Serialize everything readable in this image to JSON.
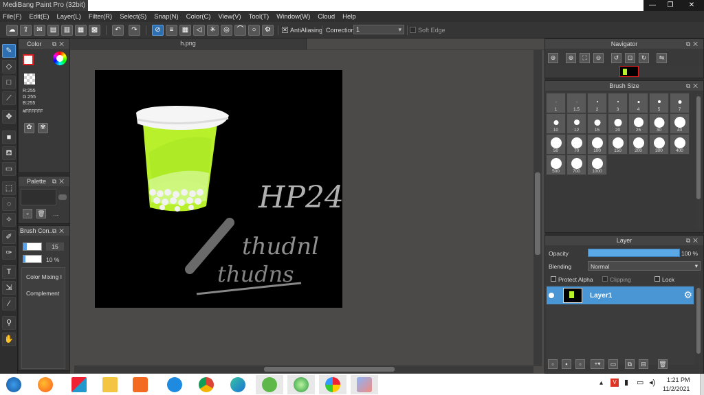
{
  "window": {
    "title": "MediBang Paint Pro (32bit)",
    "controls": [
      "—",
      "❐",
      "✕"
    ]
  },
  "menu": [
    "File(F)",
    "Edit(E)",
    "Layer(L)",
    "Filter(R)",
    "Select(S)",
    "Snap(N)",
    "Color(C)",
    "View(V)",
    "Tool(T)",
    "Window(W)",
    "Cloud",
    "Help"
  ],
  "toolbar": {
    "antialiasing_label": "AntiAliasing",
    "antialiasing_checked": true,
    "correction_label": "Correction",
    "correction_value": "1",
    "soft_edge_label": "Soft Edge",
    "soft_edge_checked": false
  },
  "color_panel": {
    "title": "Color",
    "r": "R:255",
    "g": "G:255",
    "b": "B:255",
    "hex": "#FFFFFF",
    "primary_color": "#ffffff",
    "secondary_color": "#a0a0a0"
  },
  "palette_panel": {
    "title": "Palette",
    "more": "…"
  },
  "brush_panel": {
    "title": "Brush Con...",
    "size_value": "15",
    "opacity_value": "10 %",
    "option1": "Color Mixing I",
    "option2": "Complement"
  },
  "document": {
    "tab": "h.png",
    "handwriting": [
      "HP24",
      "thudnl",
      "thudns"
    ]
  },
  "navigator": {
    "title": "Navigator"
  },
  "brush_size": {
    "title": "Brush Size",
    "sizes": [
      "1",
      "1.5",
      "2",
      "3",
      "4",
      "5",
      "7",
      "10",
      "12",
      "15",
      "20",
      "25",
      "30",
      "40",
      "50",
      "70",
      "100",
      "150",
      "200",
      "300",
      "400",
      "500",
      "700",
      "1000"
    ]
  },
  "layer_panel": {
    "title": "Layer",
    "opacity_label": "Opacity",
    "opacity_value": "100 %",
    "opacity_fraction": 1.0,
    "blending_label": "Blending",
    "blending_value": "Normal",
    "protect_alpha": "Protect Alpha",
    "clipping": "Clipping",
    "lock": "Lock",
    "layer_name": "Layer1"
  },
  "taskbar": {
    "time": "1:21 PM",
    "date": "11/2/2021"
  },
  "colors": {
    "accent": "#2d6fb0",
    "layer_selected": "#4a95d3",
    "cup_green": "#b8f02c"
  }
}
